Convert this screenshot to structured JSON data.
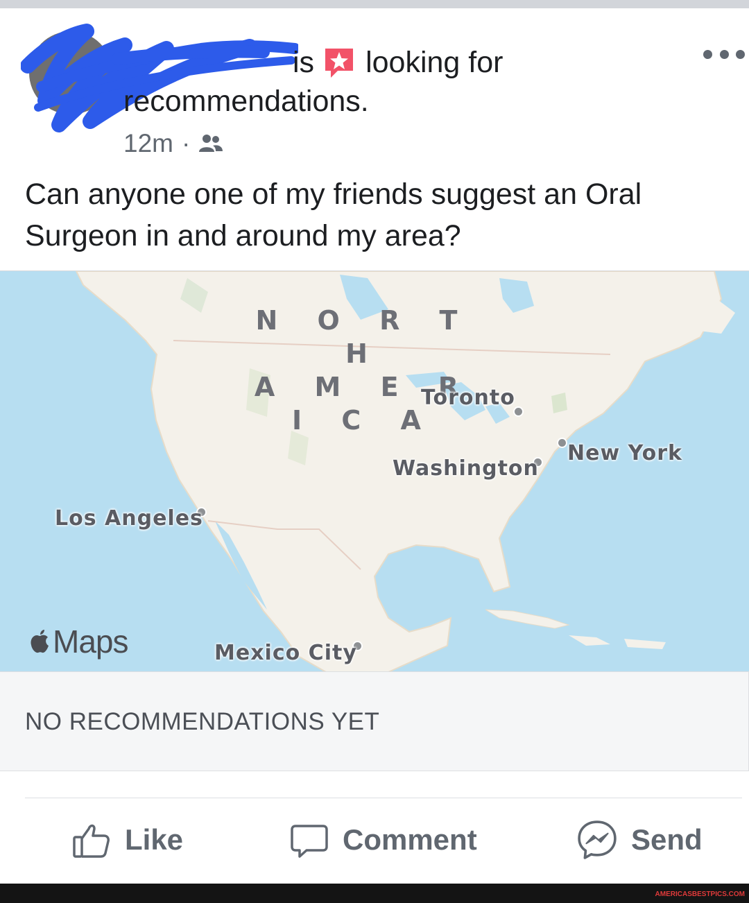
{
  "post": {
    "author_suffix": "is",
    "header_action": "looking for",
    "header_line2": "recommendations.",
    "timestamp": "12m",
    "separator": "·",
    "audience_icon": "friends-icon",
    "body_text": "Can anyone one of my friends suggest an Oral Surgeon in and around my area?"
  },
  "map": {
    "region_line1": "N O R T H",
    "region_line2": "A M E R I C A",
    "cities": {
      "toronto": "Toronto",
      "new_york": "New York",
      "washington": "Washington",
      "los_angeles": "Los Angeles",
      "mexico_city": "Mexico City"
    },
    "provider_label": "Maps",
    "provider_icon": "apple-icon"
  },
  "recommendations": {
    "status": "NO RECOMMENDATIONS YET"
  },
  "actions": {
    "like": "Like",
    "comment": "Comment",
    "send": "Send"
  },
  "watermark": "AMERICASBESTPICS.COM",
  "colors": {
    "water": "#b7def1",
    "land": "#f4f1ea",
    "recommendation_icon": "#f25268",
    "scribble": "#2d5bea"
  }
}
